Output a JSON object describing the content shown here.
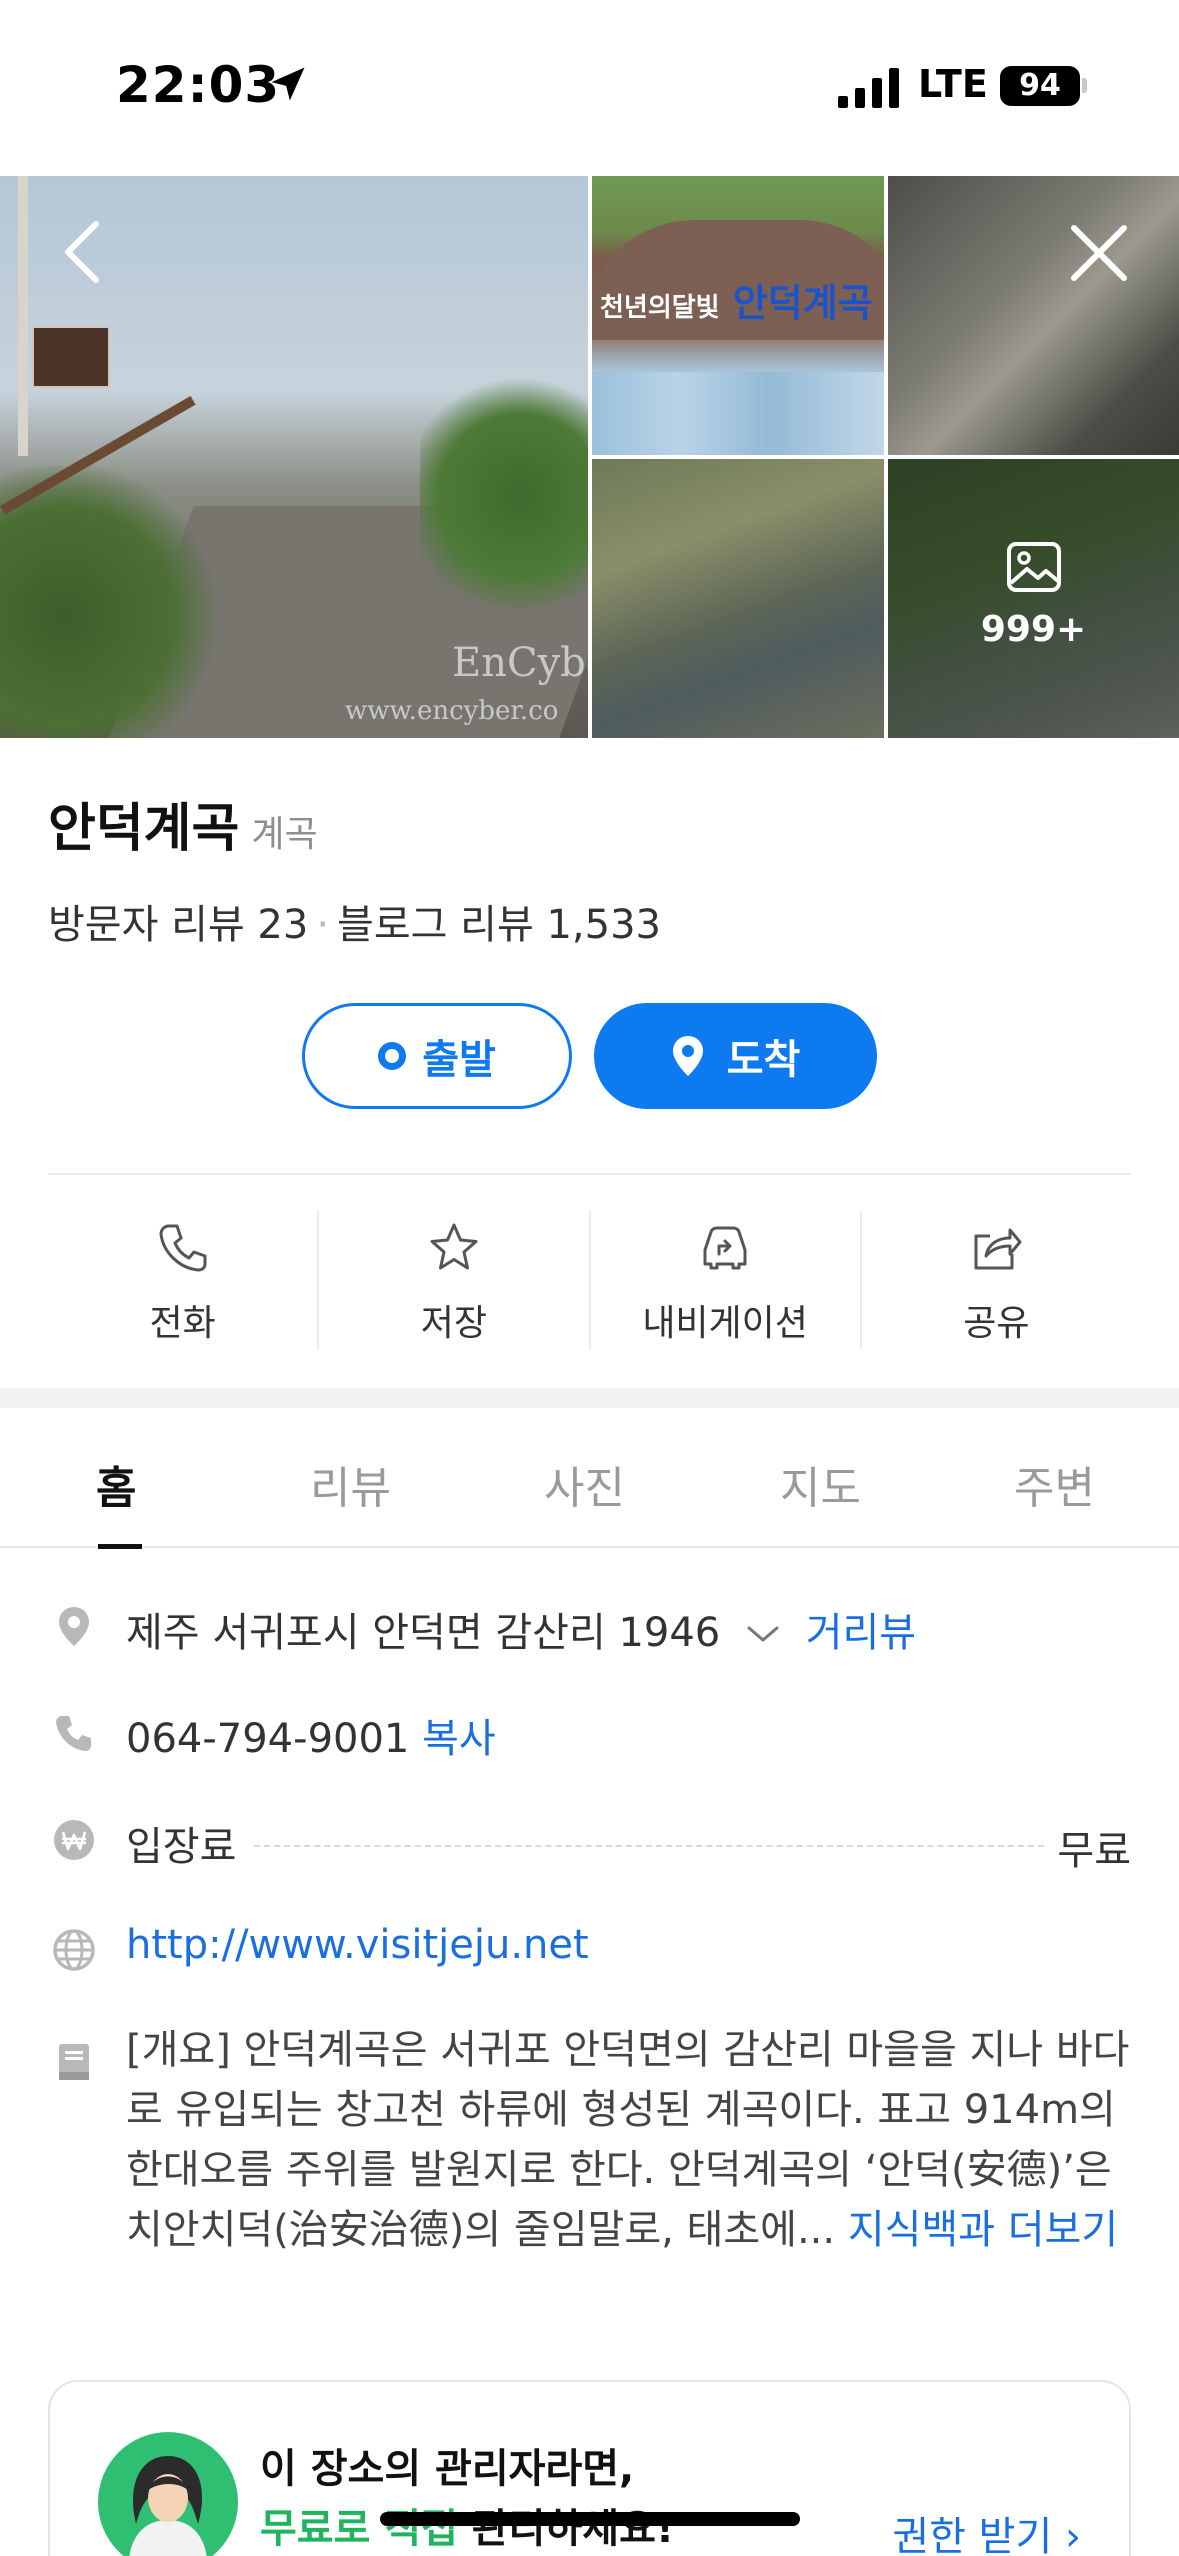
{
  "status_bar": {
    "time": "22:03",
    "network": "LTE",
    "battery": "94"
  },
  "gallery": {
    "more_count": "999+",
    "watermark_brand": "EnCybe",
    "watermark_url": "www.encyber.co",
    "sign_text_small": "천년의달빛",
    "sign_text_main": "안덕계곡"
  },
  "place": {
    "name": "안덕계곡",
    "category": "계곡",
    "visitor_review": "방문자 리뷰 23",
    "blog_review": "블로그 리뷰 1,533",
    "separator": "·"
  },
  "route": {
    "start_label": "출발",
    "arrive_label": "도착"
  },
  "actions": [
    {
      "label": "전화",
      "icon": "phone-icon"
    },
    {
      "label": "저장",
      "icon": "star-icon"
    },
    {
      "label": "내비게이션",
      "icon": "car-navigation-icon"
    },
    {
      "label": "공유",
      "icon": "share-icon"
    }
  ],
  "tabs": [
    {
      "label": "홈",
      "active": true
    },
    {
      "label": "리뷰"
    },
    {
      "label": "사진"
    },
    {
      "label": "지도"
    },
    {
      "label": "주변"
    }
  ],
  "info": {
    "address": "제주 서귀포시 안덕면 감산리 1946",
    "street_view": "거리뷰",
    "phone": "064-794-9001",
    "copy": "복사",
    "fee_label": "입장료",
    "fee_value": "무료",
    "website": "http://www.visitjeju.net",
    "description": "[개요] 안덕계곡은 서귀포 안덕면의 감산리 마을을 지나 바다로 유입되는 창고천 하류에 형성된 계곡이다. 표고 914m의 한대오름 주위를 발원지로 한다. 안덕계곡의 ‘안덕(安德)’은 치안치덕(治安治德)의 줄임말로, 태초에...",
    "description_more": "지식백과 더보기"
  },
  "manager_card": {
    "title": "이 장소의 관리자라면,",
    "sub_green": "무료로 직접",
    "sub_rest": "관리하세요!",
    "action": "권한 받기 ›"
  },
  "colors": {
    "accent": "#0d7af0",
    "link": "#1a6fe0",
    "green": "#1fb45e"
  }
}
